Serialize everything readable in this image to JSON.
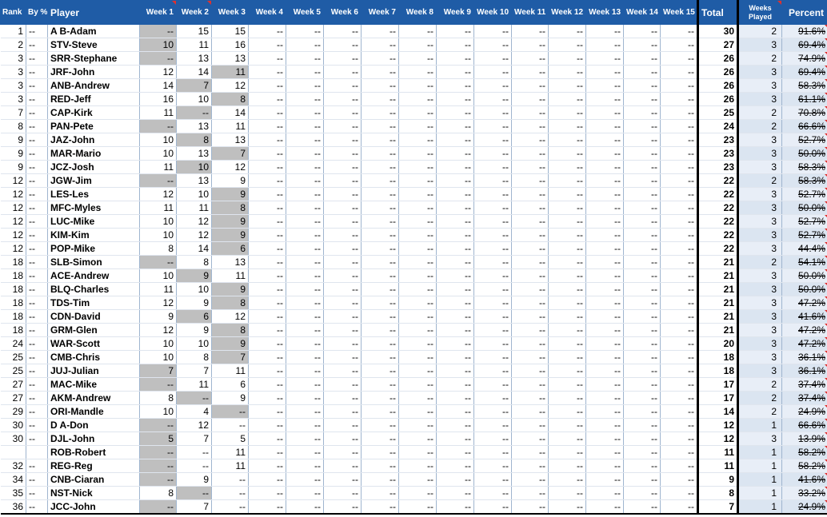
{
  "headers": {
    "rank": "Rank",
    "by_pct": "By %",
    "player": "Player",
    "weeks": [
      "Week 1",
      "Week 2",
      "Week 3",
      "Week 4",
      "Week 5",
      "Week 6",
      "Week 7",
      "Week 8",
      "Week 9",
      "Week 10",
      "Week 11",
      "Week 12",
      "Week 13",
      "Week 14",
      "Week 15"
    ],
    "total": "Total",
    "weeks_played": "Weeks Played",
    "percent": "Percent"
  },
  "colors": {
    "header_bg": "#1f5ca6",
    "shaded_cell": "#bfbfbf",
    "comment_marker": "#e0302e",
    "percent_band": "#dbe5f1"
  },
  "rows": [
    {
      "rank": "1",
      "by_pct": "--",
      "player": "A B-Adam",
      "w": [
        "--",
        "15",
        "15",
        "--",
        "--",
        "--",
        "--",
        "--",
        "--",
        "--",
        "--",
        "--",
        "--",
        "--",
        "--"
      ],
      "shade": [
        1,
        0,
        0
      ],
      "total": "30",
      "played": "2",
      "pct": "91.6%"
    },
    {
      "rank": "2",
      "by_pct": "--",
      "player": "STV-Steve",
      "w": [
        "10",
        "11",
        "16",
        "--",
        "--",
        "--",
        "--",
        "--",
        "--",
        "--",
        "--",
        "--",
        "--",
        "--",
        "--"
      ],
      "shade": [
        1,
        0,
        0
      ],
      "total": "27",
      "played": "3",
      "pct": "69.4%"
    },
    {
      "rank": "3",
      "by_pct": "--",
      "player": "SRR-Stephane",
      "w": [
        "--",
        "13",
        "13",
        "--",
        "--",
        "--",
        "--",
        "--",
        "--",
        "--",
        "--",
        "--",
        "--",
        "--",
        "--"
      ],
      "shade": [
        1,
        0,
        0
      ],
      "total": "26",
      "played": "2",
      "pct": "74.9%"
    },
    {
      "rank": "3",
      "by_pct": "--",
      "player": "JRF-John",
      "w": [
        "12",
        "14",
        "11",
        "--",
        "--",
        "--",
        "--",
        "--",
        "--",
        "--",
        "--",
        "--",
        "--",
        "--",
        "--"
      ],
      "shade": [
        0,
        0,
        1
      ],
      "total": "26",
      "played": "3",
      "pct": "69.4%"
    },
    {
      "rank": "3",
      "by_pct": "--",
      "player": "ANB-Andrew",
      "w": [
        "14",
        "7",
        "12",
        "--",
        "--",
        "--",
        "--",
        "--",
        "--",
        "--",
        "--",
        "--",
        "--",
        "--",
        "--"
      ],
      "shade": [
        0,
        1,
        0
      ],
      "total": "26",
      "played": "3",
      "pct": "58.3%"
    },
    {
      "rank": "3",
      "by_pct": "--",
      "player": "RED-Jeff",
      "w": [
        "16",
        "10",
        "8",
        "--",
        "--",
        "--",
        "--",
        "--",
        "--",
        "--",
        "--",
        "--",
        "--",
        "--",
        "--"
      ],
      "shade": [
        0,
        0,
        1
      ],
      "total": "26",
      "played": "3",
      "pct": "61.1%"
    },
    {
      "rank": "7",
      "by_pct": "--",
      "player": "CAP-Kirk",
      "w": [
        "11",
        "--",
        "14",
        "--",
        "--",
        "--",
        "--",
        "--",
        "--",
        "--",
        "--",
        "--",
        "--",
        "--",
        "--"
      ],
      "shade": [
        0,
        1,
        0
      ],
      "total": "25",
      "played": "2",
      "pct": "70.8%"
    },
    {
      "rank": "8",
      "by_pct": "--",
      "player": "PAN-Pete",
      "w": [
        "--",
        "13",
        "11",
        "--",
        "--",
        "--",
        "--",
        "--",
        "--",
        "--",
        "--",
        "--",
        "--",
        "--",
        "--"
      ],
      "shade": [
        1,
        0,
        0
      ],
      "total": "24",
      "played": "2",
      "pct": "66.6%"
    },
    {
      "rank": "9",
      "by_pct": "--",
      "player": "JAZ-John",
      "w": [
        "10",
        "8",
        "13",
        "--",
        "--",
        "--",
        "--",
        "--",
        "--",
        "--",
        "--",
        "--",
        "--",
        "--",
        "--"
      ],
      "shade": [
        0,
        1,
        0
      ],
      "total": "23",
      "played": "3",
      "pct": "52.7%"
    },
    {
      "rank": "9",
      "by_pct": "--",
      "player": "MAR-Mario",
      "w": [
        "10",
        "13",
        "7",
        "--",
        "--",
        "--",
        "--",
        "--",
        "--",
        "--",
        "--",
        "--",
        "--",
        "--",
        "--"
      ],
      "shade": [
        0,
        0,
        1
      ],
      "total": "23",
      "played": "3",
      "pct": "50.0%"
    },
    {
      "rank": "9",
      "by_pct": "--",
      "player": "JCZ-Josh",
      "w": [
        "11",
        "10",
        "12",
        "--",
        "--",
        "--",
        "--",
        "--",
        "--",
        "--",
        "--",
        "--",
        "--",
        "--",
        "--"
      ],
      "shade": [
        0,
        1,
        0
      ],
      "total": "23",
      "played": "3",
      "pct": "58.3%"
    },
    {
      "rank": "12",
      "by_pct": "--",
      "player": "JGW-Jim",
      "w": [
        "--",
        "13",
        "9",
        "--",
        "--",
        "--",
        "--",
        "--",
        "--",
        "--",
        "--",
        "--",
        "--",
        "--",
        "--"
      ],
      "shade": [
        1,
        0,
        0
      ],
      "total": "22",
      "played": "2",
      "pct": "58.3%"
    },
    {
      "rank": "12",
      "by_pct": "--",
      "player": "LES-Les",
      "w": [
        "12",
        "10",
        "9",
        "--",
        "--",
        "--",
        "--",
        "--",
        "--",
        "--",
        "--",
        "--",
        "--",
        "--",
        "--"
      ],
      "shade": [
        0,
        0,
        1
      ],
      "total": "22",
      "played": "3",
      "pct": "52.7%"
    },
    {
      "rank": "12",
      "by_pct": "--",
      "player": "MFC-Myles",
      "w": [
        "11",
        "11",
        "8",
        "--",
        "--",
        "--",
        "--",
        "--",
        "--",
        "--",
        "--",
        "--",
        "--",
        "--",
        "--"
      ],
      "shade": [
        0,
        0,
        1
      ],
      "total": "22",
      "played": "3",
      "pct": "50.0%"
    },
    {
      "rank": "12",
      "by_pct": "--",
      "player": "LUC-Mike",
      "w": [
        "10",
        "12",
        "9",
        "--",
        "--",
        "--",
        "--",
        "--",
        "--",
        "--",
        "--",
        "--",
        "--",
        "--",
        "--"
      ],
      "shade": [
        0,
        0,
        1
      ],
      "total": "22",
      "played": "3",
      "pct": "52.7%"
    },
    {
      "rank": "12",
      "by_pct": "--",
      "player": "KIM-Kim",
      "w": [
        "10",
        "12",
        "9",
        "--",
        "--",
        "--",
        "--",
        "--",
        "--",
        "--",
        "--",
        "--",
        "--",
        "--",
        "--"
      ],
      "shade": [
        0,
        0,
        1
      ],
      "total": "22",
      "played": "3",
      "pct": "52.7%"
    },
    {
      "rank": "12",
      "by_pct": "--",
      "player": "POP-Mike",
      "w": [
        "8",
        "14",
        "6",
        "--",
        "--",
        "--",
        "--",
        "--",
        "--",
        "--",
        "--",
        "--",
        "--",
        "--",
        "--"
      ],
      "shade": [
        0,
        0,
        1
      ],
      "total": "22",
      "played": "3",
      "pct": "44.4%"
    },
    {
      "rank": "18",
      "by_pct": "--",
      "player": "SLB-Simon",
      "w": [
        "--",
        "8",
        "13",
        "--",
        "--",
        "--",
        "--",
        "--",
        "--",
        "--",
        "--",
        "--",
        "--",
        "--",
        "--"
      ],
      "shade": [
        1,
        0,
        0
      ],
      "total": "21",
      "played": "2",
      "pct": "54.1%"
    },
    {
      "rank": "18",
      "by_pct": "--",
      "player": "ACE-Andrew",
      "w": [
        "10",
        "9",
        "11",
        "--",
        "--",
        "--",
        "--",
        "--",
        "--",
        "--",
        "--",
        "--",
        "--",
        "--",
        "--"
      ],
      "shade": [
        0,
        1,
        0
      ],
      "total": "21",
      "played": "3",
      "pct": "50.0%"
    },
    {
      "rank": "18",
      "by_pct": "--",
      "player": "BLQ-Charles",
      "w": [
        "11",
        "10",
        "9",
        "--",
        "--",
        "--",
        "--",
        "--",
        "--",
        "--",
        "--",
        "--",
        "--",
        "--",
        "--"
      ],
      "shade": [
        0,
        0,
        1
      ],
      "total": "21",
      "played": "3",
      "pct": "50.0%"
    },
    {
      "rank": "18",
      "by_pct": "--",
      "player": "TDS-Tim",
      "w": [
        "12",
        "9",
        "8",
        "--",
        "--",
        "--",
        "--",
        "--",
        "--",
        "--",
        "--",
        "--",
        "--",
        "--",
        "--"
      ],
      "shade": [
        0,
        0,
        1
      ],
      "total": "21",
      "played": "3",
      "pct": "47.2%"
    },
    {
      "rank": "18",
      "by_pct": "--",
      "player": "CDN-David",
      "w": [
        "9",
        "6",
        "12",
        "--",
        "--",
        "--",
        "--",
        "--",
        "--",
        "--",
        "--",
        "--",
        "--",
        "--",
        "--"
      ],
      "shade": [
        0,
        1,
        0
      ],
      "total": "21",
      "played": "3",
      "pct": "41.6%"
    },
    {
      "rank": "18",
      "by_pct": "--",
      "player": "GRM-Glen",
      "w": [
        "12",
        "9",
        "8",
        "--",
        "--",
        "--",
        "--",
        "--",
        "--",
        "--",
        "--",
        "--",
        "--",
        "--",
        "--"
      ],
      "shade": [
        0,
        0,
        1
      ],
      "total": "21",
      "played": "3",
      "pct": "47.2%"
    },
    {
      "rank": "24",
      "by_pct": "--",
      "player": "WAR-Scott",
      "w": [
        "10",
        "10",
        "9",
        "--",
        "--",
        "--",
        "--",
        "--",
        "--",
        "--",
        "--",
        "--",
        "--",
        "--",
        "--"
      ],
      "shade": [
        0,
        0,
        1
      ],
      "total": "20",
      "played": "3",
      "pct": "47.2%"
    },
    {
      "rank": "25",
      "by_pct": "--",
      "player": "CMB-Chris",
      "w": [
        "10",
        "8",
        "7",
        "--",
        "--",
        "--",
        "--",
        "--",
        "--",
        "--",
        "--",
        "--",
        "--",
        "--",
        "--"
      ],
      "shade": [
        0,
        0,
        1
      ],
      "total": "18",
      "played": "3",
      "pct": "36.1%"
    },
    {
      "rank": "25",
      "by_pct": "--",
      "player": "JUJ-Julian",
      "w": [
        "7",
        "7",
        "11",
        "--",
        "--",
        "--",
        "--",
        "--",
        "--",
        "--",
        "--",
        "--",
        "--",
        "--",
        "--"
      ],
      "shade": [
        1,
        0,
        0
      ],
      "total": "18",
      "played": "3",
      "pct": "36.1%"
    },
    {
      "rank": "27",
      "by_pct": "--",
      "player": "MAC-Mike",
      "w": [
        "--",
        "11",
        "6",
        "--",
        "--",
        "--",
        "--",
        "--",
        "--",
        "--",
        "--",
        "--",
        "--",
        "--",
        "--"
      ],
      "shade": [
        1,
        0,
        0
      ],
      "total": "17",
      "played": "2",
      "pct": "37.4%"
    },
    {
      "rank": "27",
      "by_pct": "--",
      "player": "AKM-Andrew",
      "w": [
        "8",
        "--",
        "9",
        "--",
        "--",
        "--",
        "--",
        "--",
        "--",
        "--",
        "--",
        "--",
        "--",
        "--",
        "--"
      ],
      "shade": [
        0,
        1,
        0
      ],
      "total": "17",
      "played": "2",
      "pct": "37.4%"
    },
    {
      "rank": "29",
      "by_pct": "--",
      "player": "ORI-Mandle",
      "w": [
        "10",
        "4",
        "--",
        "--",
        "--",
        "--",
        "--",
        "--",
        "--",
        "--",
        "--",
        "--",
        "--",
        "--",
        "--"
      ],
      "shade": [
        0,
        0,
        1
      ],
      "total": "14",
      "played": "2",
      "pct": "24.9%"
    },
    {
      "rank": "30",
      "by_pct": "--",
      "player": "D A-Don",
      "w": [
        "--",
        "12",
        "--",
        "--",
        "--",
        "--",
        "--",
        "--",
        "--",
        "--",
        "--",
        "--",
        "--",
        "--",
        "--"
      ],
      "shade": [
        1,
        0,
        0
      ],
      "total": "12",
      "played": "1",
      "pct": "66.6%"
    },
    {
      "rank": "30",
      "by_pct": "--",
      "player": "DJL-John",
      "w": [
        "5",
        "7",
        "5",
        "--",
        "--",
        "--",
        "--",
        "--",
        "--",
        "--",
        "--",
        "--",
        "--",
        "--",
        "--"
      ],
      "shade": [
        1,
        0,
        0
      ],
      "total": "12",
      "played": "3",
      "pct": "13.9%"
    },
    {
      "rank": "",
      "by_pct": "",
      "player": "ROB-Robert",
      "w": [
        "--",
        "--",
        "11",
        "--",
        "--",
        "--",
        "--",
        "--",
        "--",
        "--",
        "--",
        "--",
        "--",
        "--",
        "--"
      ],
      "shade": [
        1,
        0,
        0
      ],
      "total": "11",
      "played": "1",
      "pct": "58.2%"
    },
    {
      "rank": "32",
      "by_pct": "--",
      "player": "REG-Reg",
      "w": [
        "--",
        "--",
        "11",
        "--",
        "--",
        "--",
        "--",
        "--",
        "--",
        "--",
        "--",
        "--",
        "--",
        "--",
        "--"
      ],
      "shade": [
        1,
        0,
        0
      ],
      "total": "11",
      "played": "1",
      "pct": "58.2%"
    },
    {
      "rank": "34",
      "by_pct": "--",
      "player": "CNB-Ciaran",
      "w": [
        "--",
        "9",
        "--",
        "--",
        "--",
        "--",
        "--",
        "--",
        "--",
        "--",
        "--",
        "--",
        "--",
        "--",
        "--"
      ],
      "shade": [
        1,
        0,
        0
      ],
      "total": "9",
      "played": "1",
      "pct": "41.6%"
    },
    {
      "rank": "35",
      "by_pct": "--",
      "player": "NST-Nick",
      "w": [
        "8",
        "--",
        "--",
        "--",
        "--",
        "--",
        "--",
        "--",
        "--",
        "--",
        "--",
        "--",
        "--",
        "--",
        "--"
      ],
      "shade": [
        0,
        1,
        0
      ],
      "total": "8",
      "played": "1",
      "pct": "33.2%"
    },
    {
      "rank": "36",
      "by_pct": "--",
      "player": "JCC-John",
      "w": [
        "--",
        "7",
        "--",
        "--",
        "--",
        "--",
        "--",
        "--",
        "--",
        "--",
        "--",
        "--",
        "--",
        "--",
        "--"
      ],
      "shade": [
        1,
        0,
        0
      ],
      "total": "7",
      "played": "1",
      "pct": "24.9%"
    }
  ]
}
